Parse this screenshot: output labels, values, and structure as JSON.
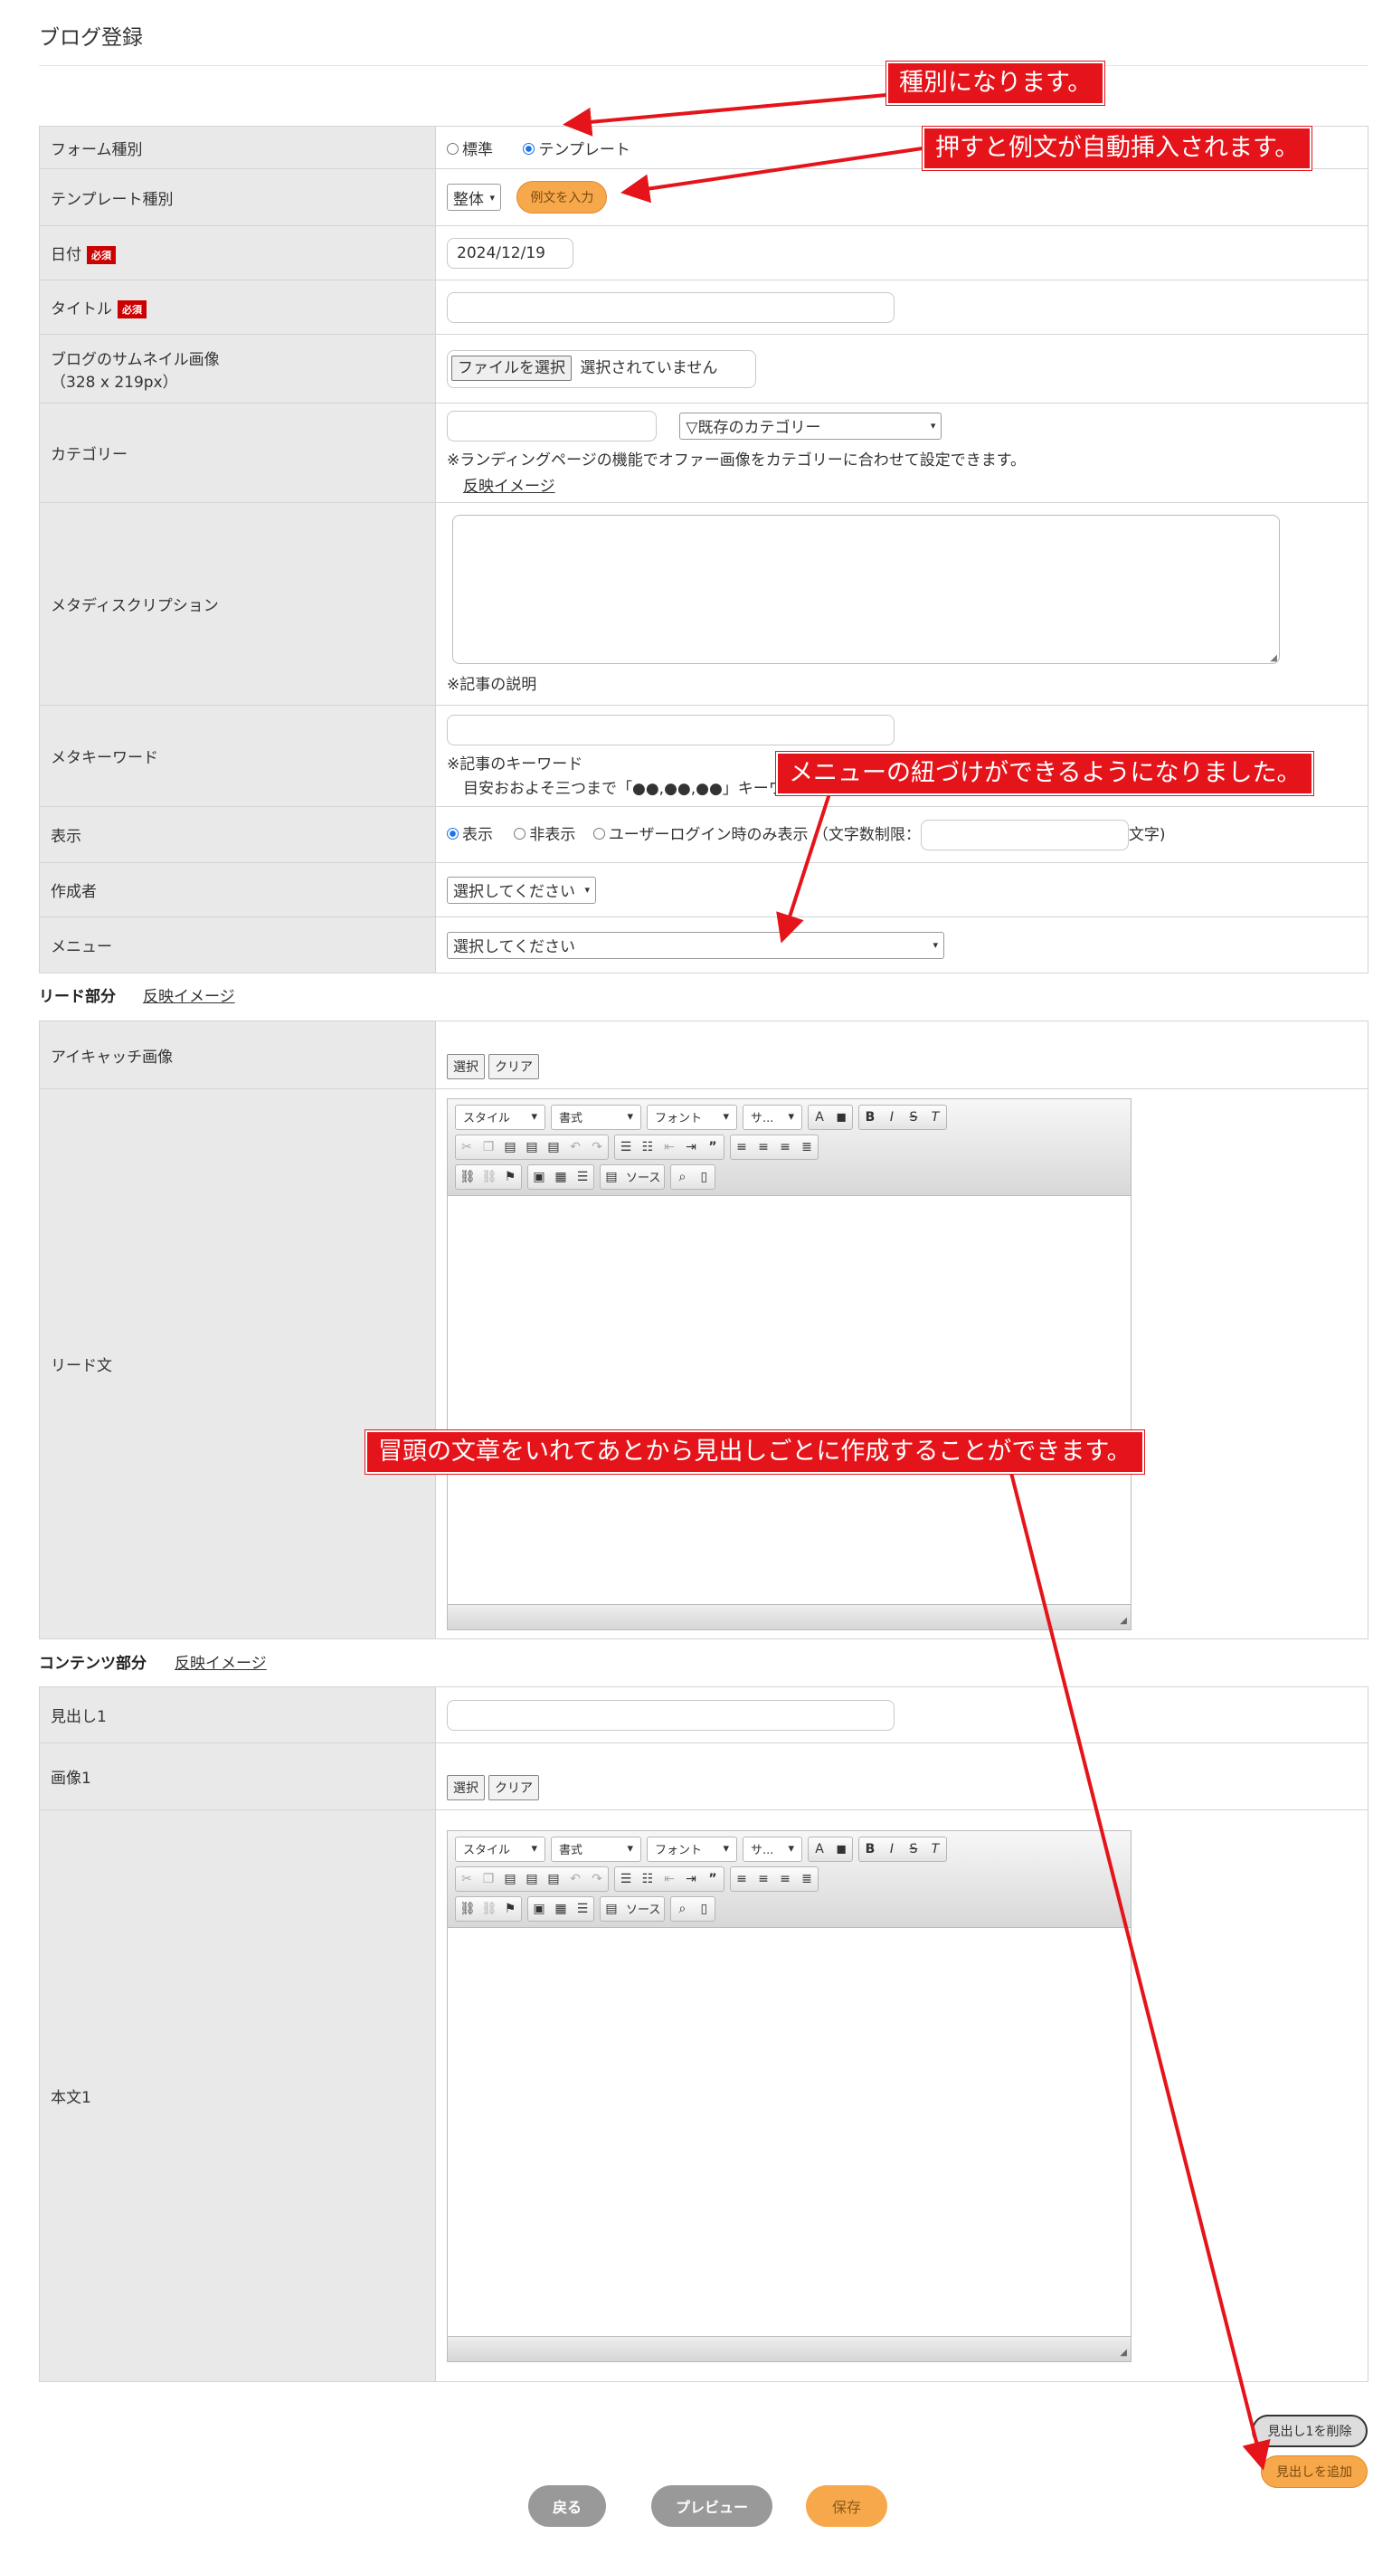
{
  "page": {
    "title": "ブログ登録"
  },
  "form": {
    "form_type": {
      "label": "フォーム種別",
      "options": [
        "標準",
        "テンプレート"
      ],
      "selected": "テンプレート"
    },
    "template_type": {
      "label": "テンプレート種別",
      "select_value": "整体",
      "button": "例文を入力"
    },
    "date": {
      "label": "日付",
      "required": "必須",
      "value": "2024/12/19"
    },
    "title": {
      "label": "タイトル",
      "required": "必須",
      "value": ""
    },
    "thumbnail": {
      "label_line1": "ブログのサムネイル画像",
      "label_line2": "（328 x 219px）",
      "file_button": "ファイルを選択",
      "file_status": "選択されていません"
    },
    "category": {
      "label": "カテゴリー",
      "select_value": "▽既存のカテゴリー",
      "note": "※ランディングページの機能でオファー画像をカテゴリーに合わせて設定できます。",
      "link": "反映イメージ"
    },
    "meta_description": {
      "label": "メタディスクリプション",
      "note": "※記事の説明"
    },
    "meta_keyword": {
      "label": "メタキーワード",
      "note1": "※記事のキーワード",
      "note2": "目安おおよそ三つまで「●●,●●,●●」キーワード間は半角カンマで区切ってください。"
    },
    "display": {
      "label": "表示",
      "options": [
        "表示",
        "非表示",
        "ユーザーログイン時のみ表示"
      ],
      "selected": "表示",
      "limit_prefix": "（文字数制限：",
      "limit_suffix": "文字)"
    },
    "author": {
      "label": "作成者",
      "select_value": "選択してください"
    },
    "menu": {
      "label": "メニュー",
      "select_value": "選択してください"
    }
  },
  "lead_section": {
    "label": "リード部分",
    "link": "反映イメージ",
    "eyecatch": {
      "label": "アイキャッチ画像",
      "select_btn": "選択",
      "clear_btn": "クリア"
    },
    "lead_text": {
      "label": "リード文"
    }
  },
  "contents_section": {
    "label": "コンテンツ部分",
    "link": "反映イメージ",
    "heading": {
      "label": "見出し1"
    },
    "image": {
      "label": "画像1",
      "select_btn": "選択",
      "clear_btn": "クリア"
    },
    "body": {
      "label": "本文1"
    }
  },
  "editor_toolbar": {
    "style": "スタイル",
    "format": "書式",
    "font": "フォント",
    "size": "サ...",
    "source": "ソース"
  },
  "heading_buttons": {
    "delete": "見出し1を削除",
    "add": "見出しを追加"
  },
  "footer_buttons": {
    "back": "戻る",
    "preview": "プレビュー",
    "save": "保存"
  },
  "callouts": {
    "form_type": "種別になります。",
    "example": "押すと例文が自動挿入されます。",
    "menu": "メニューの紐づけができるようになりました。",
    "lead": "冒頭の文章をいれてあとから見出しごとに作成することができます。"
  },
  "colors": {
    "callout": "#e5141a",
    "orange": "#f7a84a",
    "required": "#cc0000",
    "label_bg": "#e9e9e9"
  }
}
